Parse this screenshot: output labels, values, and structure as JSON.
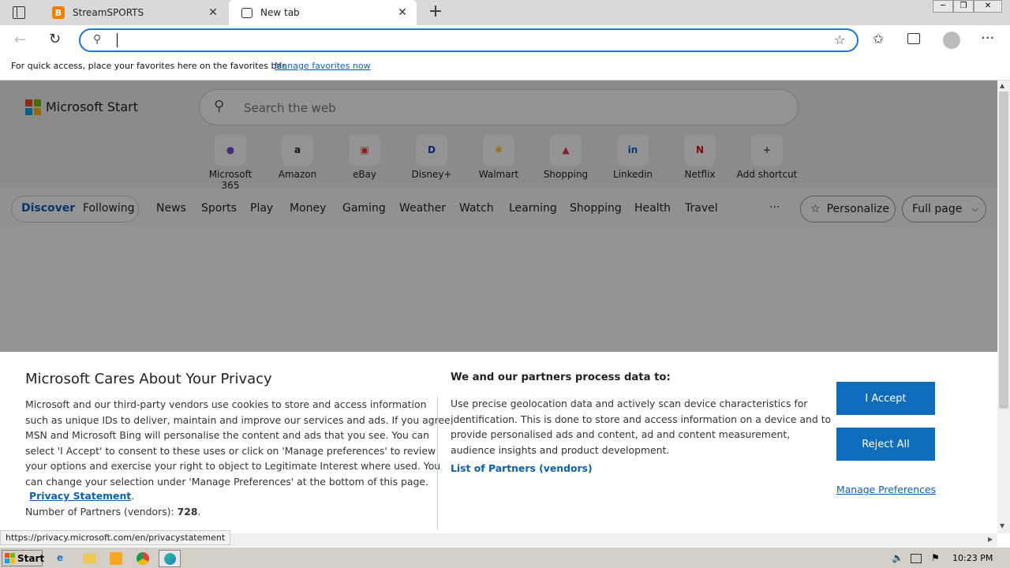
{
  "browser": {
    "tabs": [
      {
        "label": "StreamSPORTS",
        "active": false
      },
      {
        "label": "New tab",
        "active": true
      }
    ],
    "new_tab_symbol": "+",
    "close_symbol": "✕",
    "address_value": "",
    "favorites_bar": {
      "message": "For quick access, place your favorites here on the favorites bar.",
      "link": "Manage favorites now"
    },
    "window_controls": [
      "─",
      "❐",
      "✕"
    ]
  },
  "page": {
    "logo_text": "Microsoft Start",
    "search_placeholder": "Search the web",
    "shortcuts": [
      {
        "label": "Microsoft 365",
        "icon": "microsoft-365-icon",
        "glyph": "●",
        "color": "#7a4fd6"
      },
      {
        "label": "Amazon",
        "icon": "amazon-icon",
        "glyph": "a",
        "color": "#222222"
      },
      {
        "label": "eBay",
        "icon": "ebay-icon",
        "glyph": "▣",
        "color": "#e53238"
      },
      {
        "label": "Disney+",
        "icon": "disney-plus-icon",
        "glyph": "D",
        "color": "#113ccf"
      },
      {
        "label": "Walmart",
        "icon": "walmart-icon",
        "glyph": "✱",
        "color": "#ffc220"
      },
      {
        "label": "Shopping",
        "icon": "shopping-icon",
        "glyph": "▲",
        "color": "#e8344e"
      },
      {
        "label": "Linkedin",
        "icon": "linkedin-icon",
        "glyph": "in",
        "color": "#0a66c2"
      },
      {
        "label": "Netflix",
        "icon": "netflix-icon",
        "glyph": "N",
        "color": "#e50914"
      },
      {
        "label": "Add shortcut",
        "icon": "add-icon",
        "glyph": "+",
        "color": "#555555"
      }
    ],
    "nav": {
      "primary": [
        "Discover",
        "Following"
      ],
      "items": [
        "News",
        "Sports",
        "Play",
        "Money",
        "Gaming",
        "Weather",
        "Watch",
        "Learning",
        "Shopping",
        "Health",
        "Travel"
      ],
      "more": "···",
      "personalize": "Personalize",
      "layout": "Full page"
    }
  },
  "privacy": {
    "title": "Microsoft Cares About Your Privacy",
    "body_lines": [
      "Microsoft and our third-party vendors use cookies to store and access information",
      "such as unique IDs to deliver, maintain and improve our services and ads. If you agree,",
      "MSN and Microsoft Bing will personalise the content and ads that you see. You can",
      "select 'I Accept' to consent to these uses or click on 'Manage preferences' to review",
      "your options and exercise your right to object to Legitimate Interest where used.  You",
      "can change your selection under 'Manage Preferences' at the bottom of this page."
    ],
    "privacy_link": "Privacy Statement",
    "partners_label": "Number of Partners (vendors): ",
    "partners_count": "728",
    "right_title": "We and our partners process data to:",
    "right_lines": [
      "Use precise geolocation data and actively scan device characteristics for",
      "identification. This is done to store and access information on a device and to",
      "provide personalised ads and content, ad and content measurement,",
      "audience insights and product development."
    ],
    "vendors_link": "List of Partners (vendors)",
    "accept": "I Accept",
    "reject": "Reject All",
    "manage": "Manage Preferences"
  },
  "status_url": "https://privacy.microsoft.com/en/privacystatement",
  "taskbar": {
    "start": "Start",
    "clock": "10:23 PM"
  }
}
